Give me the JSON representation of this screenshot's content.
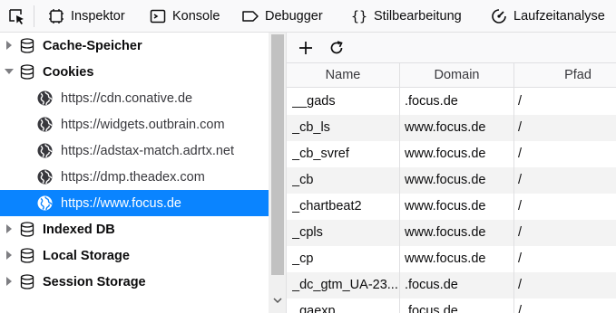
{
  "toolbar": {
    "tabs": [
      {
        "label": "Inspektor",
        "icon": "inspector-icon"
      },
      {
        "label": "Konsole",
        "icon": "console-icon"
      },
      {
        "label": "Debugger",
        "icon": "debugger-icon"
      },
      {
        "label": "Stilbearbeitung",
        "icon": "style-editor-icon"
      },
      {
        "label": "Laufzeitanalyse",
        "icon": "performance-icon"
      }
    ]
  },
  "sidebar": {
    "categories": [
      {
        "label": "Cache-Speicher",
        "expanded": false
      },
      {
        "label": "Cookies",
        "expanded": true
      },
      {
        "label": "Indexed DB",
        "expanded": false
      },
      {
        "label": "Local Storage",
        "expanded": false
      },
      {
        "label": "Session Storage",
        "expanded": false
      }
    ],
    "cookie_hosts": [
      "https://cdn.conative.de",
      "https://widgets.outbrain.com",
      "https://adstax-match.adrtx.net",
      "https://dmp.theadex.com",
      "https://www.focus.de"
    ],
    "selected_host": "https://www.focus.de"
  },
  "table": {
    "columns": [
      "Name",
      "Domain",
      "Pfad"
    ],
    "rows": [
      [
        "__gads",
        ".focus.de",
        "/"
      ],
      [
        "_cb_ls",
        "www.focus.de",
        "/"
      ],
      [
        "_cb_svref",
        "www.focus.de",
        "/"
      ],
      [
        "_cb",
        "www.focus.de",
        "/"
      ],
      [
        "_chartbeat2",
        "www.focus.de",
        "/"
      ],
      [
        "_cpls",
        "www.focus.de",
        "/"
      ],
      [
        "_cp",
        "www.focus.de",
        "/"
      ],
      [
        "_dc_gtm_UA-23...",
        ".focus.de",
        "/"
      ],
      [
        "_gaexp",
        ".focus.de",
        "/"
      ]
    ]
  },
  "colors": {
    "selection": "#0a84ff",
    "toolbar_bg": "#f9f9fa",
    "row_alt": "#f3f3f3"
  }
}
